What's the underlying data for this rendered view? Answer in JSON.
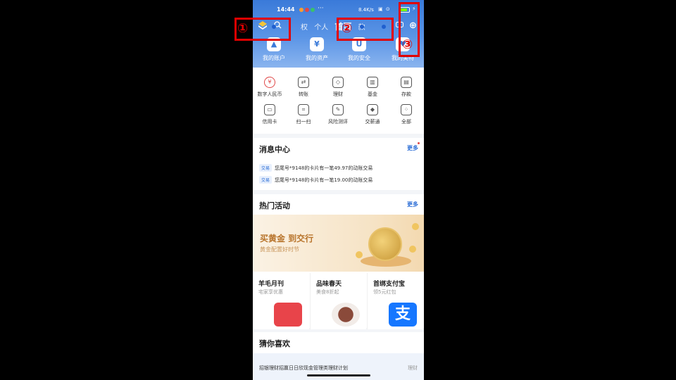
{
  "status_bar": {
    "time": "14:44",
    "more": "···",
    "speed": "8.4K/s",
    "icons": "▣ ⊙",
    "bolt": "⚡"
  },
  "top_bar": {
    "tabs": [
      "权",
      "个人",
      "首页",
      "款"
    ],
    "add_glyph": "⊕"
  },
  "quick_actions": [
    {
      "label": "我的账户",
      "glyph": "▲"
    },
    {
      "label": "我的资产",
      "glyph": "¥"
    },
    {
      "label": "我的安全",
      "glyph": "U"
    },
    {
      "label": "我的美特",
      "glyph": "♥"
    }
  ],
  "services": [
    {
      "label": "数字人民币",
      "glyph": "¥",
      "icon": "digital-rmb-icon"
    },
    {
      "label": "转账",
      "glyph": "⇄",
      "icon": "transfer-icon"
    },
    {
      "label": "理财",
      "glyph": "◇",
      "icon": "wealth-icon"
    },
    {
      "label": "基金",
      "glyph": "▥",
      "icon": "fund-icon"
    },
    {
      "label": "存款",
      "glyph": "▤",
      "icon": "deposit-icon"
    },
    {
      "label": "信用卡",
      "glyph": "▭",
      "icon": "credit-card-icon"
    },
    {
      "label": "扫一扫",
      "glyph": "⌗",
      "icon": "scan-icon"
    },
    {
      "label": "风险测评",
      "glyph": "✎",
      "icon": "risk-test-icon"
    },
    {
      "label": "交薪通",
      "glyph": "◆",
      "icon": "salary-icon"
    },
    {
      "label": "全部",
      "glyph": "⁘",
      "icon": "all-icon"
    }
  ],
  "message_center": {
    "title": "消息中心",
    "more": "更多",
    "messages": [
      {
        "tag": "交易",
        "text": "您尾号*9148的卡片有一笔49.97的动账交易"
      },
      {
        "tag": "交易",
        "text": "您尾号*9148的卡片有一笔19.00的动账交易"
      }
    ]
  },
  "hot_activities": {
    "title": "热门活动",
    "more": "更多",
    "banner_title": "买黄金 到交行",
    "banner_sub": "黄金配置好时节",
    "promos": [
      {
        "title": "羊毛月刊",
        "sub": "宅家享优惠",
        "color": "#e8444a"
      },
      {
        "title": "品味春天",
        "sub": "美食8折起",
        "color": "#8a4a3a"
      },
      {
        "title": "首绑支付宝",
        "sub": "领5元红包",
        "color": "#1677ff"
      }
    ]
  },
  "guess": {
    "title": "猜你喜欢",
    "item": "招银理财招赢日日欣现金管理类理财计划",
    "tag": "理财"
  },
  "annotations": [
    "①",
    "②",
    "③"
  ]
}
